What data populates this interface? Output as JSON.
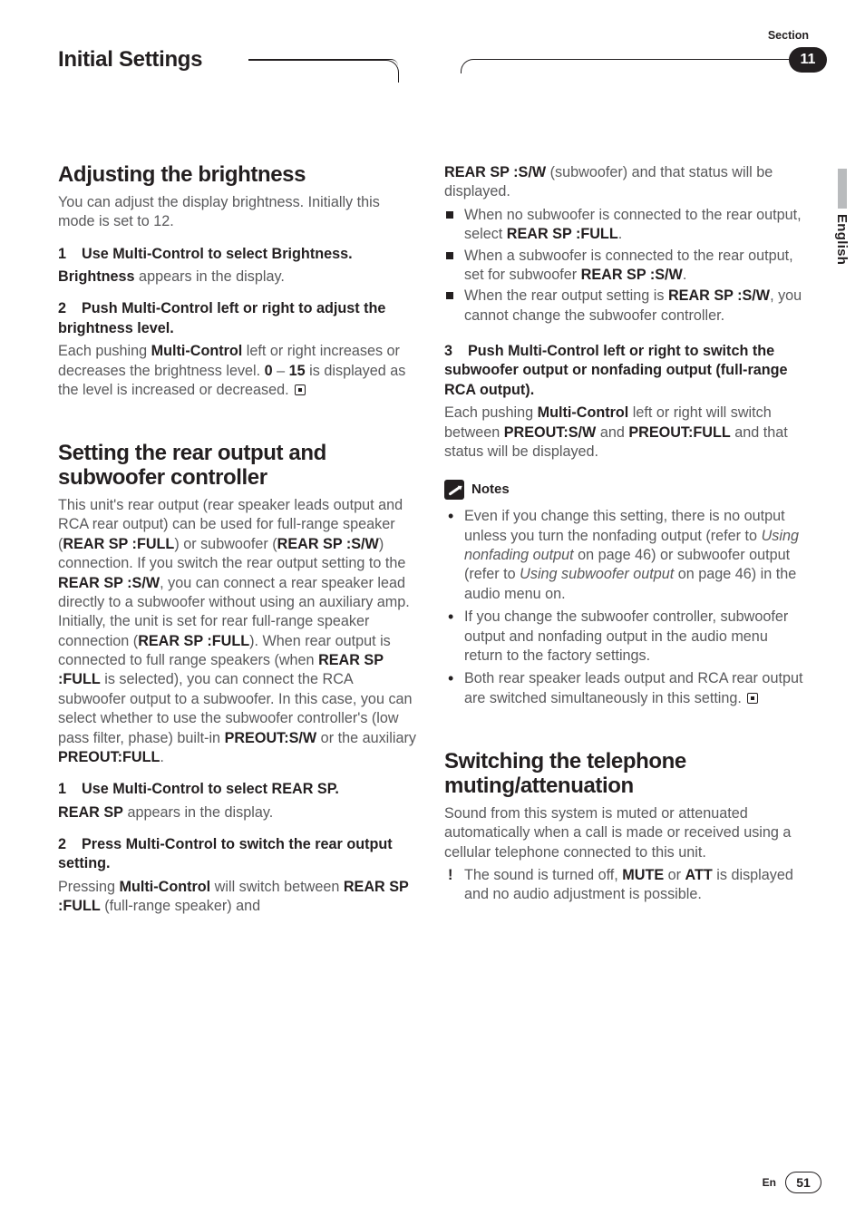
{
  "header": {
    "section_label": "Section",
    "chapter_title": "Initial Settings",
    "section_number": "11"
  },
  "side_tab": {
    "language": "English"
  },
  "footer": {
    "lang_code": "En",
    "page": "51"
  },
  "left": {
    "h_brightness": "Adjusting the brightness",
    "brightness_intro": "You can adjust the display brightness. Initially this mode is set to 12.",
    "b_step1_head_num": "1",
    "b_step1_head": "Use Multi-Control to select Brightness.",
    "b_step1_body_a": "Brightness",
    "b_step1_body_b": " appears in the display.",
    "b_step2_head_num": "2",
    "b_step2_head": "Push Multi-Control left or right to adjust the brightness level.",
    "b_step2_body_a": "Each pushing ",
    "b_step2_body_b": "Multi-Control",
    "b_step2_body_c": " left or right increases or decreases the brightness level. ",
    "b_step2_body_d": "0",
    "b_step2_body_e": " – ",
    "b_step2_body_f": "15",
    "b_step2_body_g": " is displayed as the level is increased or decreased.",
    "h_rear": "Setting the rear output and subwoofer controller",
    "rear_p_a": "This unit's rear output (rear speaker leads output and RCA rear output) can be used for full-range speaker (",
    "rear_p_b": "REAR SP :FULL",
    "rear_p_c": ") or subwoofer (",
    "rear_p_d": "REAR SP :S/W",
    "rear_p_e": ") connection. If you switch the rear output setting to the ",
    "rear_p_f": "REAR SP :S/W",
    "rear_p_g": ", you can connect a rear speaker lead directly to a subwoofer without using an auxiliary amp. Initially, the unit is set for rear full-range speaker connection (",
    "rear_p_h": "REAR SP :FULL",
    "rear_p_i": "). When rear output is connected to full range speakers (when ",
    "rear_p_j": "REAR SP :FULL",
    "rear_p_k": " is selected), you can connect the RCA subwoofer output to a subwoofer. In this case, you can select whether to use the subwoofer controller's (low pass filter, phase) built-in ",
    "rear_p_l": "PREOUT:S/W",
    "rear_p_m": " or the auxiliary ",
    "rear_p_n": "PREOUT:FULL",
    "rear_p_o": ".",
    "r_step1_num": "1",
    "r_step1_head": "Use Multi-Control to select REAR SP.",
    "r_step1_body_a": "REAR SP",
    "r_step1_body_b": " appears in the display.",
    "r_step2_num": "2",
    "r_step2_head": "Press Multi-Control to switch the rear output setting.",
    "r_step2_body_a": "Pressing ",
    "r_step2_body_b": "Multi-Control",
    "r_step2_body_c": " will switch between ",
    "r_step2_body_d": "REAR SP :FULL",
    "r_step2_body_e": " (full-range speaker) and"
  },
  "right": {
    "cont_a": "REAR SP :S/W",
    "cont_b": " (subwoofer) and that status will be displayed.",
    "bul1_a": "When no subwoofer is connected to the rear output, select ",
    "bul1_b": "REAR SP :FULL",
    "bul1_c": ".",
    "bul2_a": "When a subwoofer is connected to the rear output, set for subwoofer ",
    "bul2_b": "REAR SP :S/W",
    "bul2_c": ".",
    "bul3_a": "When the rear output setting is ",
    "bul3_b": "REAR SP :S/W",
    "bul3_c": ", you cannot change the subwoofer controller.",
    "r_step3_num": "3",
    "r_step3_head": "Push Multi-Control left or right to switch the subwoofer output or nonfading output (full-range RCA output).",
    "r_step3_body_a": "Each pushing ",
    "r_step3_body_b": "Multi-Control",
    "r_step3_body_c": " left or right will switch between ",
    "r_step3_body_d": "PREOUT:S/W",
    "r_step3_body_e": " and ",
    "r_step3_body_f": "PREOUT:FULL",
    "r_step3_body_g": " and that status will be displayed.",
    "notes_label": "Notes",
    "note1_a": "Even if you change this setting, there is no output unless you turn the nonfading output (refer to ",
    "note1_b": "Using nonfading output",
    "note1_c": " on page 46) or subwoofer output (refer to ",
    "note1_d": "Using subwoofer output",
    "note1_e": " on page 46) in the audio menu on.",
    "note2": "If you change the subwoofer controller, subwoofer output and nonfading output in the audio menu return to the factory settings.",
    "note3": "Both rear speaker leads output and RCA rear output are switched simultaneously in this setting.",
    "h_tel": "Switching the telephone muting/attenuation",
    "tel_intro": "Sound from this system is muted or attenuated automatically when a call is made or received using a cellular telephone connected to this unit.",
    "tel_b1_a": "The sound is turned off, ",
    "tel_b1_b": "MUTE",
    "tel_b1_c": " or ",
    "tel_b1_d": "ATT",
    "tel_b1_e": " is displayed and no audio adjustment is possible."
  }
}
